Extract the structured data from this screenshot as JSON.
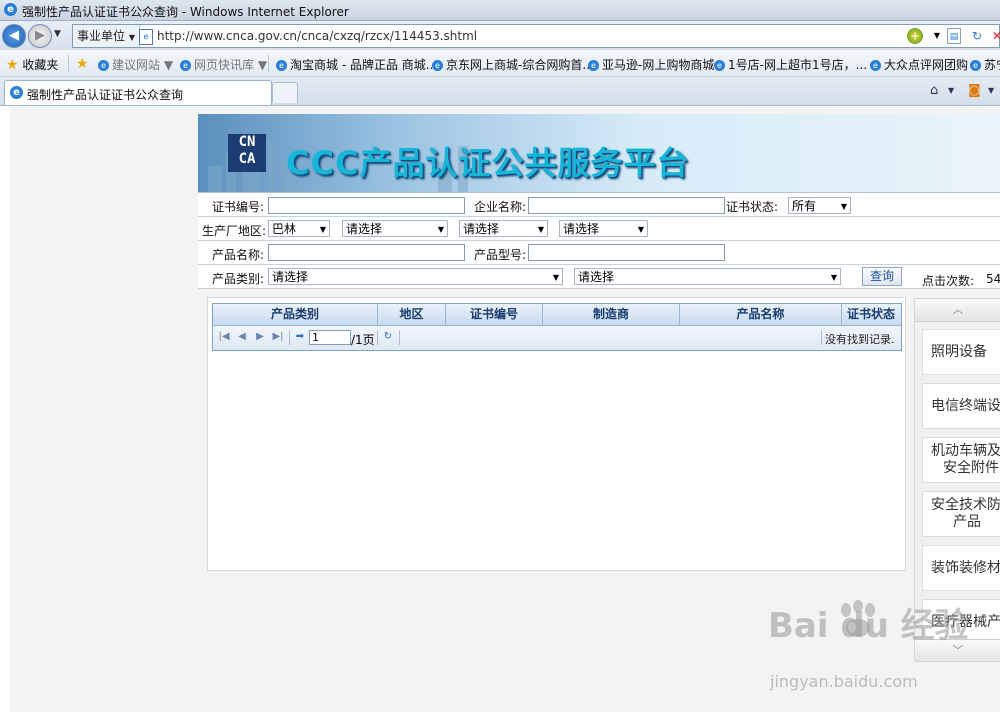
{
  "window": {
    "title": "强制性产品认证证书公众查询 - Windows Internet Explorer"
  },
  "address_bar": {
    "zone_label": "事业单位",
    "url": "http://www.cnca.gov.cn/cnca/cxzq/rzcx/114453.shtml"
  },
  "favorites_bar": {
    "favorites_label": "收藏夹",
    "items": [
      {
        "label": "建议网站 ▼",
        "muted": true
      },
      {
        "label": "网页快讯库 ▼",
        "muted": true
      },
      {
        "label": "淘宝商城 - 品牌正品 商城..."
      },
      {
        "label": "京东网上商城-综合网购首..."
      },
      {
        "label": "亚马逊-网上购物商城"
      },
      {
        "label": "1号店-网上超市1号店，..."
      },
      {
        "label": "大众点评网团购"
      },
      {
        "label": "苏宁"
      }
    ]
  },
  "tab": {
    "title": "强制性产品认证证书公众查询"
  },
  "banner": {
    "logo_text_line1": "CN",
    "logo_text_line2": "CA",
    "title": "CCC产品认证公共服务平台"
  },
  "search_form": {
    "cert_number_label": "证书编号:",
    "company_name_label": "企业名称:",
    "cert_status_label": "证书状态:",
    "cert_status_value": "所有",
    "region_label": "生产厂地区:",
    "region_country_value": "巴林",
    "region_select_2": "请选择",
    "region_select_3": "请选择",
    "region_select_4": "请选择",
    "product_name_label": "产品名称:",
    "product_model_label": "产品型号:",
    "product_category_label": "产品类别:",
    "category_select_1": "请选择",
    "category_select_2": "请选择",
    "query_button": "查询",
    "click_count_label": "点击次数:",
    "click_count_value": "54"
  },
  "results_grid": {
    "columns": [
      "产品类别",
      "地区",
      "证书编号",
      "制造商",
      "产品名称",
      "证书状态"
    ],
    "page_input": "1",
    "page_total": "/1页",
    "empty_message": "没有找到记录."
  },
  "category_panel": {
    "items": [
      {
        "line1": "照明设备",
        "line2": ""
      },
      {
        "line1": "电信终端设",
        "line2": ""
      },
      {
        "line1": "机动车辆及",
        "line2": "安全附件"
      },
      {
        "line1": "安全技术防",
        "line2": "产品"
      },
      {
        "line1": "装饰装修材",
        "line2": ""
      },
      {
        "line1": "医疗器械产",
        "line2": ""
      }
    ]
  },
  "watermark": {
    "brand": "Bai du 经验",
    "url": "jingyan.baidu.com"
  },
  "colors": {
    "banner_title": "#17b6d9",
    "grid_header": "#c7daf0",
    "ie_blue": "#2a7fd6"
  }
}
